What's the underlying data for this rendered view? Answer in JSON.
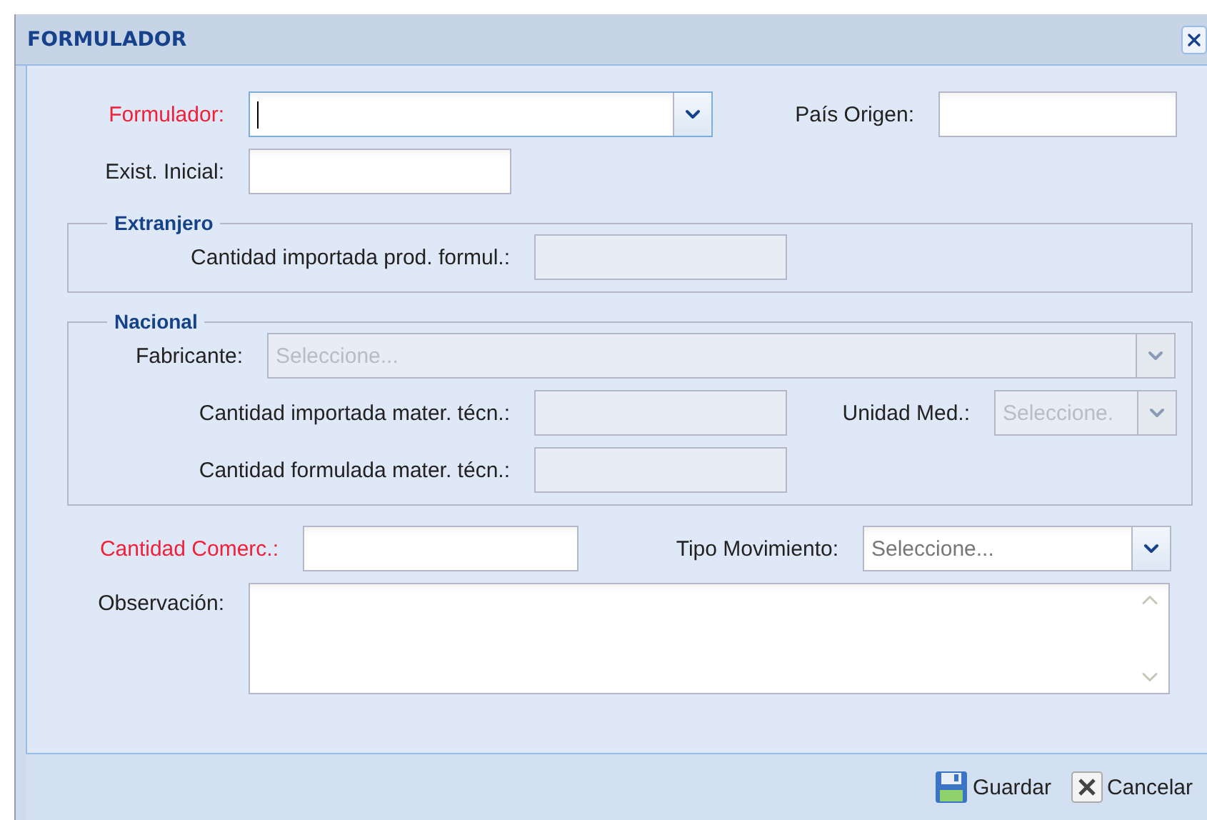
{
  "window": {
    "title": "FORMULADOR"
  },
  "main_fields": [
    {
      "label": "Formulador:",
      "kind": "combo",
      "required": true,
      "focused": true,
      "disabled": false
    },
    {
      "label": "País Origen:",
      "kind": "text",
      "required": false,
      "focused": false,
      "disabled": false
    },
    {
      "label": "Exist. Inicial:",
      "kind": "text",
      "required": false,
      "focused": false,
      "disabled": false
    }
  ],
  "extranjero": {
    "legend": "Extranjero",
    "fields": [
      {
        "label": "Cantidad importada prod. formul.:",
        "kind": "text",
        "required": false,
        "focused": false,
        "disabled": true
      }
    ]
  },
  "nacional": {
    "legend": "Nacional",
    "fields": [
      {
        "label": "Fabricante:",
        "kind": "combo",
        "placeholder": "Seleccione...",
        "required": false,
        "focused": false,
        "disabled": true
      },
      {
        "label": "Cantidad importada mater. técn.:",
        "kind": "text",
        "required": false,
        "focused": false,
        "disabled": true
      },
      {
        "label": "Unidad Med.:",
        "kind": "combo",
        "placeholder": "Seleccione.",
        "required": false,
        "focused": false,
        "disabled": true
      },
      {
        "label": "Cantidad formulada mater. técn.:",
        "kind": "text",
        "required": false,
        "focused": false,
        "disabled": true
      }
    ]
  },
  "bottom_fields": [
    {
      "label": "Cantidad Comerc.:",
      "kind": "text",
      "required": true,
      "focused": false,
      "disabled": false
    },
    {
      "label": "Tipo Movimiento:",
      "kind": "combo",
      "placeholder": "Seleccione...",
      "required": false,
      "focused": false,
      "disabled": false
    },
    {
      "label": "Observación:",
      "kind": "textarea",
      "required": false,
      "focused": false,
      "disabled": false
    }
  ],
  "buttons": [
    {
      "label": "Guardar",
      "kind": "save"
    },
    {
      "label": "Cancelar",
      "kind": "cancel"
    }
  ]
}
